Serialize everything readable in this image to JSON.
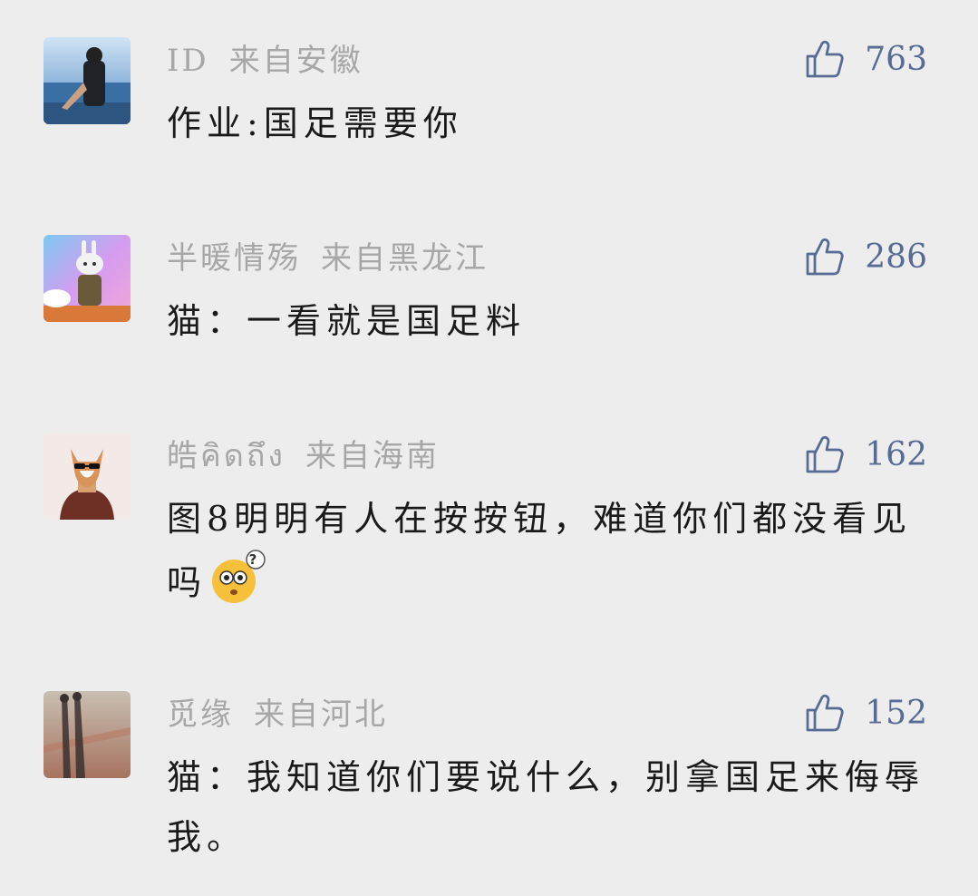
{
  "colors": {
    "background": "#ededed",
    "meta_text": "#a7a7a7",
    "body_text": "#1a1a1a",
    "like_accent": "#576b95"
  },
  "comments": [
    {
      "username": "ID",
      "location": "来自安徽",
      "likes": "763",
      "text": "作业:国足需要你",
      "avatar": "sea-photo-avatar"
    },
    {
      "username": "半暖情殇",
      "location": "来自黑龙江",
      "likes": "286",
      "text": "猫：一看就是国足料",
      "avatar": "rabbit-avatar"
    },
    {
      "username": "皓คิดถึง",
      "location": "来自海南",
      "likes": "162",
      "text": "图8明明有人在按按钮，难道你们都没看见吗",
      "avatar": "dog-avatar",
      "emoji": "flushed-question-emoji"
    },
    {
      "username": "觅缘",
      "location": "来自河北",
      "likes": "152",
      "text": "猫：我知道你们要说什么，别拿国足来侮辱我。",
      "avatar": "shadow-couple-avatar"
    }
  ]
}
